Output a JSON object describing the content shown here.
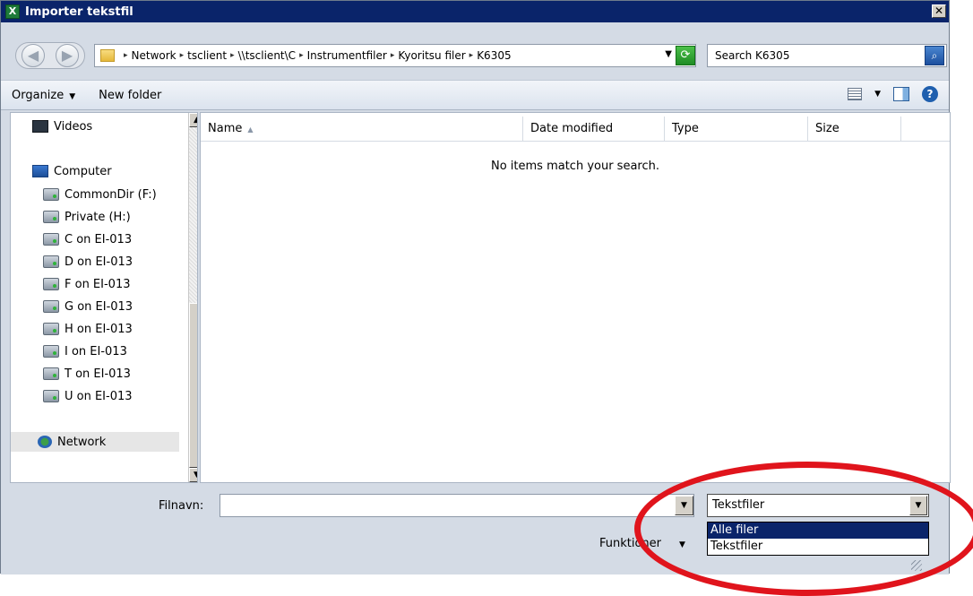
{
  "window": {
    "title": "Importer tekstfil",
    "close_glyph": "✕",
    "app_icon_glyph": "X"
  },
  "address_bar": {
    "crumbs": [
      "Network",
      "tsclient",
      "\\\\tsclient\\C",
      "Instrumentfiler",
      "Kyoritsu filer",
      "K6305"
    ],
    "separator": "▸",
    "dropdown_glyph": "▼",
    "refresh_glyph": "⟳",
    "back_glyph": "◀",
    "forward_glyph": "▶"
  },
  "search": {
    "value": "Search K6305",
    "icon_glyph": "⌕"
  },
  "toolbar": {
    "organize_label": "Organize",
    "new_folder_label": "New folder",
    "caret": "▼",
    "help_glyph": "?"
  },
  "nav": {
    "items": [
      {
        "label": "Videos",
        "icon": "videos-icon"
      },
      {
        "label": "Computer",
        "icon": "computer-icon"
      },
      {
        "label": "CommonDir (F:)",
        "icon": "network-drive-icon"
      },
      {
        "label": "Private (H:)",
        "icon": "network-drive-icon"
      },
      {
        "label": "C on EI-013",
        "icon": "network-drive-icon"
      },
      {
        "label": "D on EI-013",
        "icon": "network-drive-icon"
      },
      {
        "label": "F on EI-013",
        "icon": "network-drive-icon"
      },
      {
        "label": "G on EI-013",
        "icon": "network-drive-icon"
      },
      {
        "label": "H on EI-013",
        "icon": "network-drive-icon"
      },
      {
        "label": "I on EI-013",
        "icon": "network-drive-icon"
      },
      {
        "label": "T on EI-013",
        "icon": "network-drive-icon"
      },
      {
        "label": "U on EI-013",
        "icon": "network-drive-icon"
      },
      {
        "label": "Network",
        "icon": "network-icon"
      }
    ],
    "scroll_up_glyph": "▲",
    "scroll_down_glyph": "▼"
  },
  "file_list": {
    "columns": [
      "Name",
      "Date modified",
      "Type",
      "Size"
    ],
    "sort_glyph": "▲",
    "empty_message": "No items match your search."
  },
  "footer": {
    "filename_label": "Filnavn:",
    "filename_value": "",
    "filetype_selected": "Tekstfiler",
    "filetype_options": [
      "Alle filer",
      "Tekstfiler"
    ],
    "tools_label": "Funktioner",
    "caret": "▼"
  },
  "colors": {
    "titlebar": "#0a246a",
    "dialog_bg": "#d4dbe5",
    "highlight": "#0a246a",
    "annotation_red": "#e0141c"
  }
}
